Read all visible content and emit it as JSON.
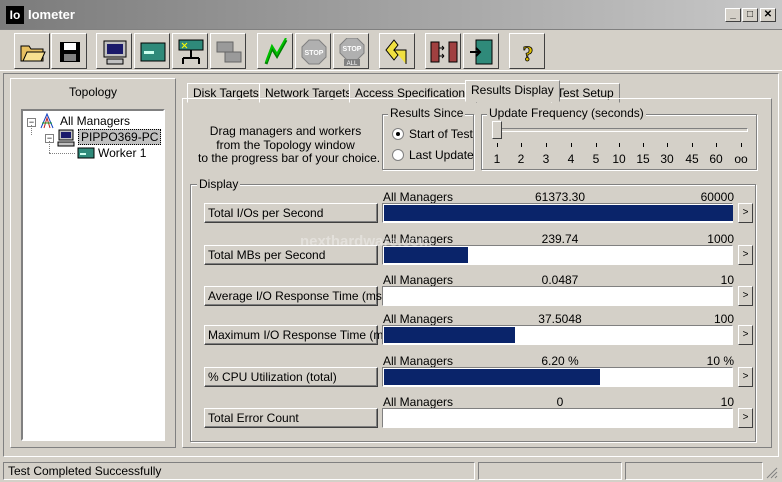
{
  "window": {
    "icon_text": "Io",
    "title": "Iometer",
    "minimize": "_",
    "maximize": "□",
    "close": "✕"
  },
  "toolbar": [
    {
      "name": "open-config-icon"
    },
    {
      "name": "save-config-icon"
    },
    {
      "name": "new-manager-icon"
    },
    {
      "name": "new-disk-worker-icon"
    },
    {
      "name": "new-network-worker-icon"
    },
    {
      "name": "duplicate-worker-icon"
    },
    {
      "name": "start-tests-icon"
    },
    {
      "name": "stop-test-icon"
    },
    {
      "name": "stop-all-icon"
    },
    {
      "name": "reset-workers-icon"
    },
    {
      "name": "disconnect-manager-icon"
    },
    {
      "name": "exit-icon"
    },
    {
      "name": "help-icon"
    }
  ],
  "topology": {
    "title": "Topology",
    "root": "All Managers",
    "manager": "PIPPO369-PC",
    "worker": "Worker 1"
  },
  "tabs": [
    "Disk Targets",
    "Network Targets",
    "Access Specifications",
    "Results Display",
    "Test Setup"
  ],
  "instructions": [
    "Drag managers and workers",
    "from the Topology window",
    "to the progress bar of your choice."
  ],
  "results_since": {
    "label": "Results Since",
    "options": [
      "Start of Test",
      "Last Update"
    ],
    "selected": "Start of Test"
  },
  "update_frequency": {
    "label": "Update Frequency (seconds)",
    "ticks": [
      "1",
      "2",
      "3",
      "4",
      "5",
      "10",
      "15",
      "30",
      "45",
      "60",
      "oo"
    ],
    "selected": "1"
  },
  "display": {
    "label": "Display",
    "rows": [
      {
        "metric": "Total I/Os per Second",
        "source": "All Managers",
        "value": "61373.30",
        "max": "60000",
        "fill": 1.0
      },
      {
        "metric": "Total MBs per Second",
        "source": "All Managers",
        "value": "239.74",
        "max": "1000",
        "fill": 0.24
      },
      {
        "metric": "Average I/O Response Time (ms)",
        "source": "All Managers",
        "value": "0.0487",
        "max": "10",
        "fill": 0.0
      },
      {
        "metric": "Maximum I/O Response Time (ms)",
        "source": "All Managers",
        "value": "37.5048",
        "max": "100",
        "fill": 0.375
      },
      {
        "metric": "% CPU Utilization (total)",
        "source": "All Managers",
        "value": "6.20 %",
        "max": "10 %",
        "fill": 0.62
      },
      {
        "metric": "Total Error Count",
        "source": "All Managers",
        "value": "0",
        "max": "10",
        "fill": 0.0
      }
    ],
    "arrow": ">"
  },
  "watermark": "nexthardware.com",
  "status": {
    "message": "Test Completed Successfully"
  }
}
